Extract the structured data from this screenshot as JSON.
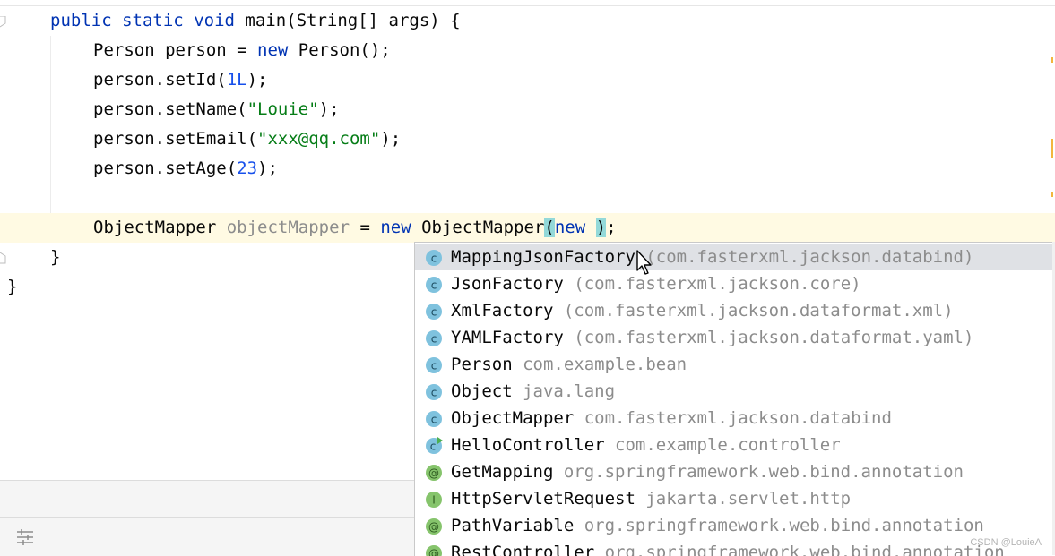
{
  "code": {
    "line1": {
      "kw1": "public",
      "kw2": "static",
      "kw3": "void",
      "rest": "main(String[] args) {"
    },
    "line2": {
      "a": "Person person = ",
      "kw": "new",
      "b": " Person();"
    },
    "line3": {
      "a": "person.setId(",
      "num": "1L",
      "b": ");"
    },
    "line4": {
      "a": "person.setName(",
      "str": "\"Louie\"",
      "b": ");"
    },
    "line5": {
      "a": "person.setEmail(",
      "str": "\"xxx@qq.com\"",
      "b": ");"
    },
    "line6": {
      "a": "person.setAge(",
      "num": "23",
      "b": ");"
    },
    "line8": {
      "type": "ObjectMapper",
      "var": "objectMapper",
      "eq": " = ",
      "kw": "new",
      "call": " ObjectMapper",
      "open": "(",
      "kw2": "new",
      "space": " ",
      "close": ")",
      "semi": ";"
    },
    "line9": "}",
    "line10": "}"
  },
  "completion": {
    "items": [
      {
        "icon": "class-icon",
        "name": "MappingJsonFactory",
        "pkg": " (com.fasterxml.jackson.databind)"
      },
      {
        "icon": "class-icon",
        "name": "JsonFactory",
        "pkg": " (com.fasterxml.jackson.core)"
      },
      {
        "icon": "class-icon",
        "name": "XmlFactory",
        "pkg": " (com.fasterxml.jackson.dataformat.xml)"
      },
      {
        "icon": "class-icon",
        "name": "YAMLFactory",
        "pkg": " (com.fasterxml.jackson.dataformat.yaml)"
      },
      {
        "icon": "class-icon",
        "name": "Person",
        "pkg": " com.example.bean"
      },
      {
        "icon": "class-icon",
        "name": "Object",
        "pkg": " java.lang"
      },
      {
        "icon": "class-icon",
        "name": "ObjectMapper",
        "pkg": " com.fasterxml.jackson.databind"
      },
      {
        "icon": "runnable-class-icon",
        "name": "HelloController",
        "pkg": " com.example.controller"
      },
      {
        "icon": "annotation-icon",
        "name": "GetMapping",
        "pkg": " org.springframework.web.bind.annotation"
      },
      {
        "icon": "interface-icon",
        "name": "HttpServletRequest",
        "pkg": " jakarta.servlet.http"
      },
      {
        "icon": "annotation-icon",
        "name": "PathVariable",
        "pkg": " org.springframework.web.bind.annotation"
      },
      {
        "icon": "annotation-icon",
        "name": "RestController",
        "pkg": " org.springframework.web.bind.annotation"
      }
    ]
  },
  "watermark": "CSDN @LouieA",
  "colors": {
    "keyword": "#0033b3",
    "string": "#067d17",
    "number": "#1750eb",
    "class_icon": "#7fc2de",
    "annotation_icon": "#86c46c",
    "selection": "#dfe1e5",
    "current_line": "#fffae3"
  }
}
